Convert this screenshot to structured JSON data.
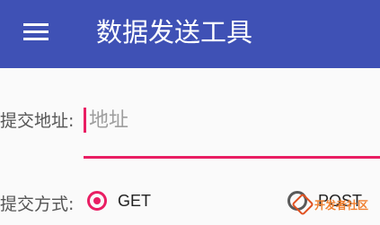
{
  "app_bar": {
    "menu_icon": "hamburger-menu-icon",
    "title": "数据发送工具",
    "background": "#3f51b5"
  },
  "form": {
    "address": {
      "label": "提交地址:",
      "placeholder": "地址",
      "value": ""
    },
    "method": {
      "label": "提交方式:",
      "options": [
        {
          "label": "GET",
          "selected": true
        },
        {
          "label": "POST",
          "selected": false
        }
      ]
    }
  },
  "watermark": {
    "text": "开发者社区"
  },
  "colors": {
    "accent": "#e91e63",
    "primary": "#3f51b5"
  }
}
